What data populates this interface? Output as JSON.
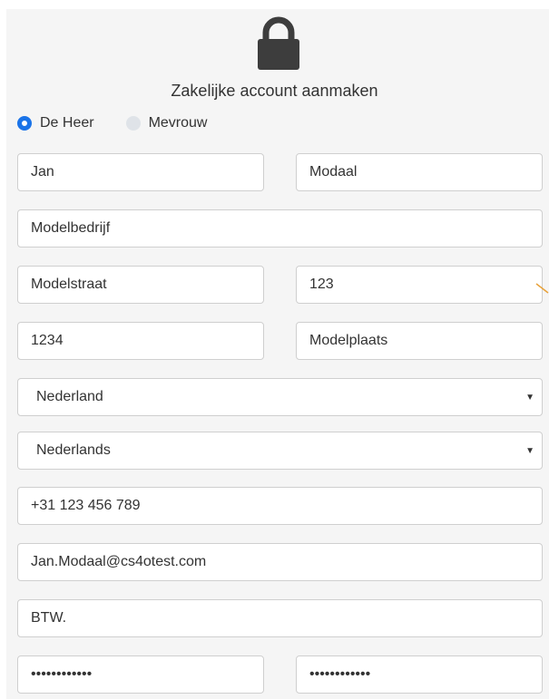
{
  "form": {
    "title": "Zakelijke account aanmaken",
    "salutation": {
      "options": [
        "De Heer",
        "Mevrouw"
      ],
      "selected": "De Heer"
    },
    "first_name": "Jan",
    "last_name": "Modaal",
    "company": "Modelbedrijf",
    "street": "Modelstraat",
    "house_number": "123",
    "postal_code": "1234",
    "city": "Modelplaats",
    "country": "Nederland",
    "language": "Nederlands",
    "phone": "+31 123 456 789",
    "email": "Jan.Modaal@cs4otest.com",
    "vat": "BTW.",
    "password": "••••••••••••",
    "password_confirm": "••••••••••••"
  },
  "icons": {
    "lock": "lock-icon",
    "select_caret": "caret-down-icon"
  },
  "colors": {
    "accent": "#1a73e8",
    "panel_bg": "#f5f5f5",
    "border": "#cfcfcf"
  }
}
